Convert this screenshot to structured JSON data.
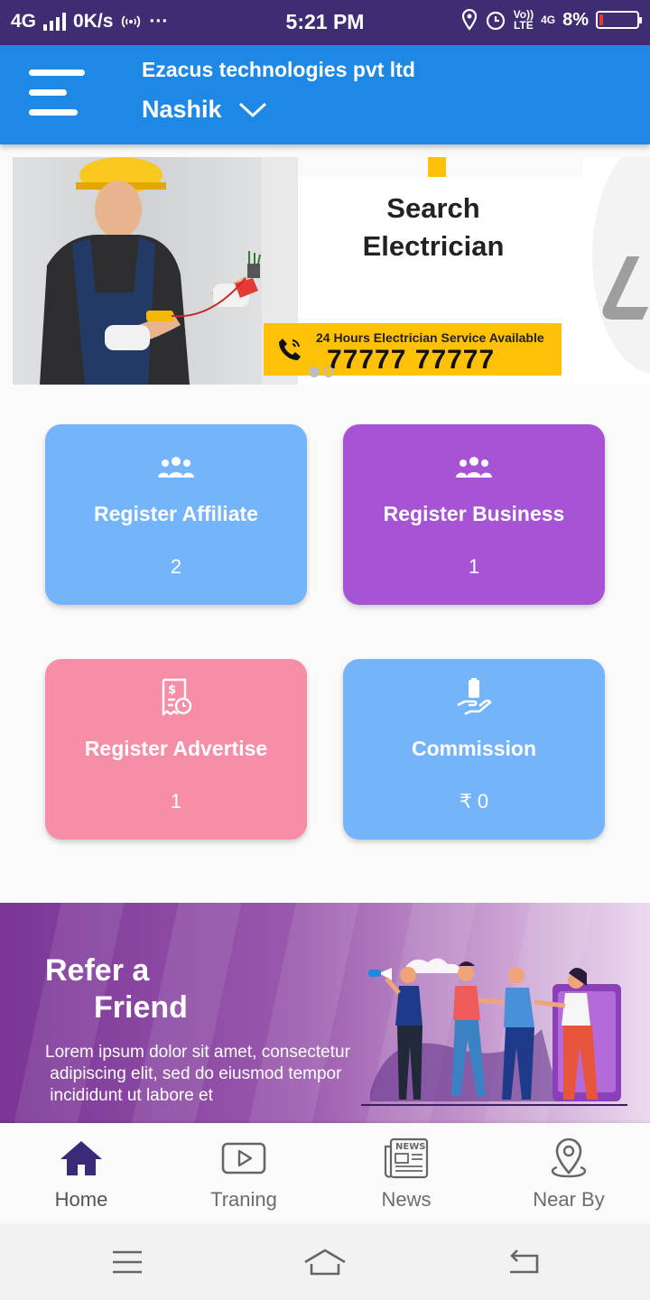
{
  "status_bar": {
    "network": "4G",
    "speed": "0K/s",
    "extra": "···",
    "time": "5:21 PM",
    "volte_top": "Vo))",
    "volte_bottom": "LTE",
    "net_type": "4G",
    "battery": "8%",
    "colors": {
      "background": "#3f2d73",
      "battery_low": "#e53935"
    }
  },
  "app_bar": {
    "company": "Ezacus technologies pvt ltd",
    "city": "Nashik",
    "icons": [
      "menu-icon",
      "chevron-down-icon"
    ],
    "colors": {
      "background": "#1e88e5"
    }
  },
  "banner": {
    "title_line1": "Search",
    "title_line2": "Electrician",
    "service_text": "24 Hours Electrician Service Available",
    "phone": "77777 77777",
    "slides": 2,
    "active_slide": 1,
    "colors": {
      "accent": "#ffc107"
    }
  },
  "cards": [
    {
      "label": "Register Affiliate",
      "count": "2",
      "icon": "group-icon",
      "color": "#73b4fb"
    },
    {
      "label": "Register Business",
      "count": "1",
      "icon": "group-icon",
      "color": "#a653d6"
    },
    {
      "label": "Register Advertise",
      "count": "1",
      "icon": "receipt-icon",
      "color": "#f78ea8"
    },
    {
      "label": "Commission",
      "count": "₹  0",
      "icon": "hand-payment-icon",
      "color": "#73b4fb"
    }
  ],
  "refer": {
    "title_line1": "Refer a",
    "title_line2": "Friend",
    "body_line1": "Lorem ipsum dolor sit amet, consectetur",
    "body_line2": " adipiscing elit, sed do eiusmod tempor",
    "body_line3": " incididunt ut labore et"
  },
  "bottom_nav": [
    {
      "label": "Home",
      "icon": "home-icon",
      "active": true
    },
    {
      "label": "Traning",
      "icon": "play-icon",
      "active": false
    },
    {
      "label": "News",
      "icon": "news-icon",
      "active": false
    },
    {
      "label": "Near By",
      "icon": "location-pin-icon",
      "active": false
    }
  ],
  "system_nav": {
    "icons": [
      "recents-icon",
      "home-outline-icon",
      "back-icon"
    ]
  }
}
